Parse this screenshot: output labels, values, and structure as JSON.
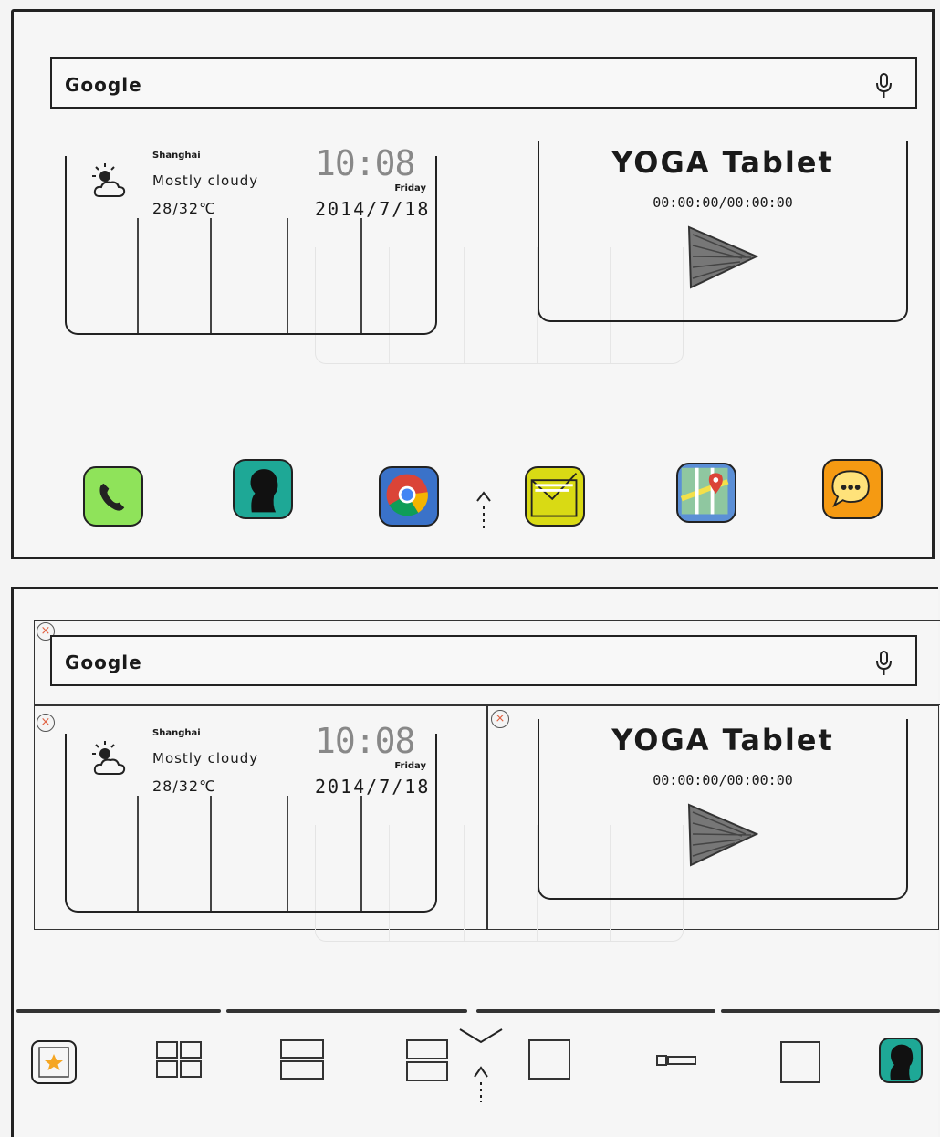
{
  "search": {
    "label": "Google"
  },
  "weather": {
    "city": "Shanghai",
    "condition": "Mostly cloudy",
    "temperature": "28/32℃",
    "time": "10:08",
    "day": "Friday",
    "date": "2014/7/18"
  },
  "video": {
    "title": "YOGA Tablet",
    "time": "00:00:00/00:00:00"
  },
  "dock": {
    "icons": [
      "phone-icon",
      "contacts-icon",
      "chrome-icon",
      "email-icon",
      "maps-icon",
      "messaging-icon"
    ]
  },
  "edit_mode": {
    "remove_glyph": "×"
  },
  "widget_tray": {
    "items": [
      "favorites-widget",
      "grid-2x2-widget",
      "stack-2-widget",
      "stack-2-small-widget",
      "single-widget",
      "wide-small-widget",
      "square-widget",
      "contacts-widget"
    ]
  },
  "colors": {
    "phone": "#8fe35a",
    "contacts": "#1ea896",
    "email": "#d9da14",
    "messaging": "#f59a12",
    "close": "#e06040"
  }
}
